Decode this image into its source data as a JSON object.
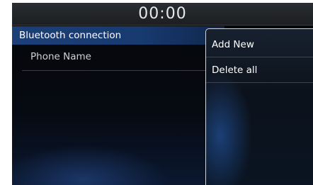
{
  "status_bar": {
    "clock": "00:00"
  },
  "bluetooth": {
    "title": "Bluetooth connection",
    "devices": [
      {
        "name": "Phone Name"
      }
    ]
  },
  "menu": {
    "items": [
      {
        "label": "Add New"
      },
      {
        "label": "Delete all"
      }
    ]
  }
}
